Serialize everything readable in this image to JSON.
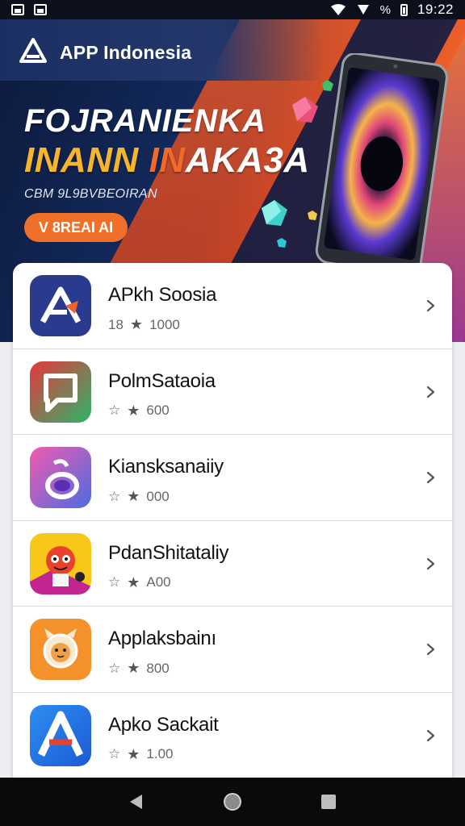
{
  "status_bar": {
    "time": "19:22",
    "signal_label": "%",
    "icons": [
      "photo-icon",
      "image-icon",
      "wifi-icon",
      "signal-icon",
      "battery-icon"
    ]
  },
  "banner": {
    "brand": "APP Indonesia",
    "headline_line1": "FOJRANIENKA",
    "headline_line2_a": "INANN ",
    "headline_line2_b": "IN",
    "headline_line2_c": "AKA3A",
    "subline": "CBM 9L9BVBEOIRAN",
    "cta_label": "V 8REAI AI"
  },
  "apps": [
    {
      "name": "APkh Soosia",
      "rating_prefix": "18",
      "count": "1000",
      "icon": "triangle-a-logo-icon",
      "colors": [
        "#2a3a8f",
        "#1e2a6e"
      ]
    },
    {
      "name": "PolmSataoia",
      "rating_prefix": "☆",
      "count": "600",
      "icon": "chat-bubble-icon",
      "colors": [
        "#e6373b",
        "#2cb56b"
      ]
    },
    {
      "name": "Kiansksanaiiy",
      "rating_prefix": "☆",
      "count": "000",
      "icon": "music-note-icon",
      "colors": [
        "#f25bb0",
        "#4c6ce0"
      ]
    },
    {
      "name": "PdanShitataliy",
      "rating_prefix": "☆",
      "count": "A00",
      "icon": "cartoon-character-icon",
      "colors": [
        "#f9c61a",
        "#e8412e"
      ]
    },
    {
      "name": "Applaksbainı",
      "rating_prefix": "☆",
      "count": "800",
      "icon": "cartoon-cat-icon",
      "colors": [
        "#f5912a",
        "#e76a15"
      ]
    },
    {
      "name": "Apko Sackait",
      "rating_prefix": "☆",
      "count": "1.00",
      "icon": "letter-a-icon",
      "colors": [
        "#2c8ef0",
        "#1c5ad4"
      ]
    }
  ],
  "nav": {
    "back": "back-icon",
    "home": "home-icon",
    "recents": "recents-icon"
  }
}
